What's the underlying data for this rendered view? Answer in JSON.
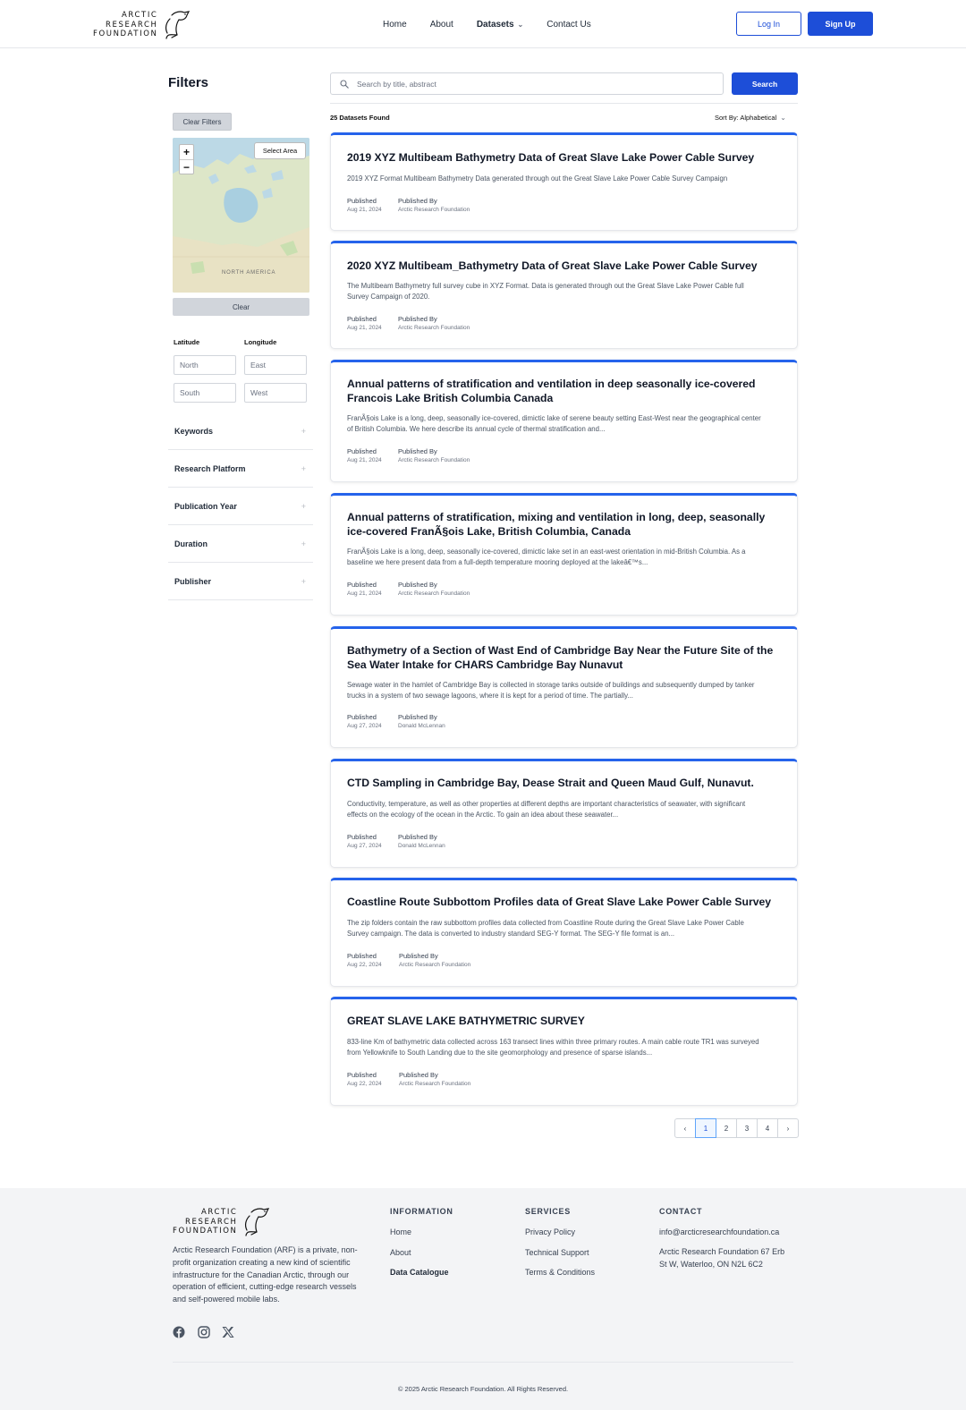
{
  "brand": {
    "logo_lines": [
      "ARCTIC",
      "RESEARCH",
      "FOUNDATION"
    ]
  },
  "nav": {
    "links": [
      "Home",
      "About",
      "Datasets",
      "Contact Us"
    ],
    "login": "Log In",
    "signup": "Sign Up"
  },
  "filters": {
    "title": "Filters",
    "clear_filters": "Clear Filters",
    "select_area": "Select Area",
    "zoom_in": "+",
    "zoom_out": "−",
    "map_label": "NORTH AMERICA",
    "map_clear": "Clear",
    "latitude_label": "Latitude",
    "longitude_label": "Longitude",
    "north_placeholder": "North",
    "east_placeholder": "East",
    "south_placeholder": "South",
    "west_placeholder": "West",
    "facets": [
      "Keywords",
      "Research Platform",
      "Publication Year",
      "Duration",
      "Publisher"
    ],
    "facet_toggle": "+"
  },
  "search": {
    "placeholder": "Search by title, abstract",
    "button": "Search"
  },
  "results": {
    "count_text": "25 Datasets Found",
    "sort_text": "Sort By: Alphabetical",
    "published_label": "Published",
    "published_by_label": "Published By",
    "datasets": [
      {
        "title": "2019 XYZ Multibeam Bathymetry Data of Great Slave Lake Power Cable Survey",
        "description": "2019 XYZ Format Multibeam Bathymetry Data generated through out the Great Slave Lake Power Cable Survey Campaign",
        "date": "Aug 21, 2024",
        "publisher": "Arctic Research Foundation"
      },
      {
        "title": "2020 XYZ Multibeam_Bathymetry Data of Great Slave Lake Power Cable Survey",
        "description": "The Multibeam Bathymetry full survey cube in XYZ Format. Data is generated through out the Great Slave Lake Power Cable full Survey Campaign of 2020.",
        "date": "Aug 21, 2024",
        "publisher": "Arctic Research Foundation"
      },
      {
        "title": "Annual patterns of stratification and ventilation in deep seasonally ice-covered Francois Lake British Columbia Canada",
        "description": "FranÃ§ois Lake is a long, deep, seasonally ice-covered, dimictic lake of serene beauty setting East-West near the geographical center of British Columbia. We here describe its annual cycle of thermal stratification and...",
        "date": "Aug 21, 2024",
        "publisher": "Arctic Research Foundation"
      },
      {
        "title": "Annual patterns of stratification, mixing and ventilation in long, deep, seasonally ice-covered FranÃ§ois Lake, British Columbia, Canada",
        "description": "FranÃ§ois Lake is a long, deep, seasonally ice-covered, dimictic lake set in an east-west orientation in mid-British Columbia. As a baseline we here present data from a full-depth temperature mooring deployed at the lakeâ€™s...",
        "date": "Aug 21, 2024",
        "publisher": "Arctic Research Foundation"
      },
      {
        "title": "Bathymetry of a Section of Wast End of Cambridge Bay Near the Future Site of the Sea Water Intake for CHARS Cambridge Bay Nunavut",
        "description": "Sewage water in the hamlet of Cambridge Bay is collected in storage tanks outside of buildings and subsequently dumped by tanker trucks in a system of two sewage lagoons, where it is kept for a period of time. The partially...",
        "date": "Aug 27, 2024",
        "publisher": "Donald McLennan"
      },
      {
        "title": "CTD Sampling in Cambridge Bay, Dease Strait and Queen Maud Gulf, Nunavut.",
        "description": "Conductivity, temperature, as well as other properties at different depths are important characteristics of seawater, with significant effects on the ecology of the ocean in the Arctic. To gain an idea about these seawater...",
        "date": "Aug 27, 2024",
        "publisher": "Donald McLennan"
      },
      {
        "title": "Coastline Route Subbottom Profiles data of Great Slave Lake Power Cable Survey",
        "description": "The zip folders contain the raw subbottom profiles data collected from Coastline Route during the Great Slave Lake Power Cable Survey campaign. The data is converted to industry standard SEG-Y format. The SEG-Y file format is an...",
        "date": "Aug 22, 2024",
        "publisher": "Arctic Research Foundation"
      },
      {
        "title": "GREAT SLAVE LAKE BATHYMETRIC SURVEY",
        "description": "833-line Km of bathymetric data collected across 163 transect lines within three primary routes. A main cable route TR1 was surveyed from Yellowknife to South Landing due to the site geomorphology and presence of sparse islands...",
        "date": "Aug 22, 2024",
        "publisher": "Arctic Research Foundation"
      }
    ]
  },
  "pagination": {
    "prev": "‹",
    "pages": [
      "1",
      "2",
      "3",
      "4"
    ],
    "next": "›",
    "current": "1"
  },
  "footer": {
    "about": "Arctic Research Foundation (ARF) is a private, non-profit organization creating a new kind of scientific infrastructure for the Canadian Arctic, through our operation of efficient, cutting-edge research vessels and self-powered mobile labs.",
    "information_title": "INFORMATION",
    "information_links": [
      "Home",
      "About",
      "Data Catalogue"
    ],
    "services_title": "SERVICES",
    "services_links": [
      "Privacy Policy",
      "Technical Support",
      "Terms & Conditions"
    ],
    "contact_title": "CONTACT",
    "email": "info@arcticresearchfoundation.ca",
    "address": "Arctic Research Foundation 67 Erb St W, Waterloo, ON N2L 6C2",
    "social_icons": [
      "facebook-icon",
      "instagram-icon",
      "x-icon"
    ],
    "copyright": "© 2025 Arctic Research Foundation. All Rights Reserved."
  },
  "colors": {
    "accent": "#1d4ed8",
    "card_top": "#2563eb",
    "footer_bg": "#f3f4f6"
  }
}
